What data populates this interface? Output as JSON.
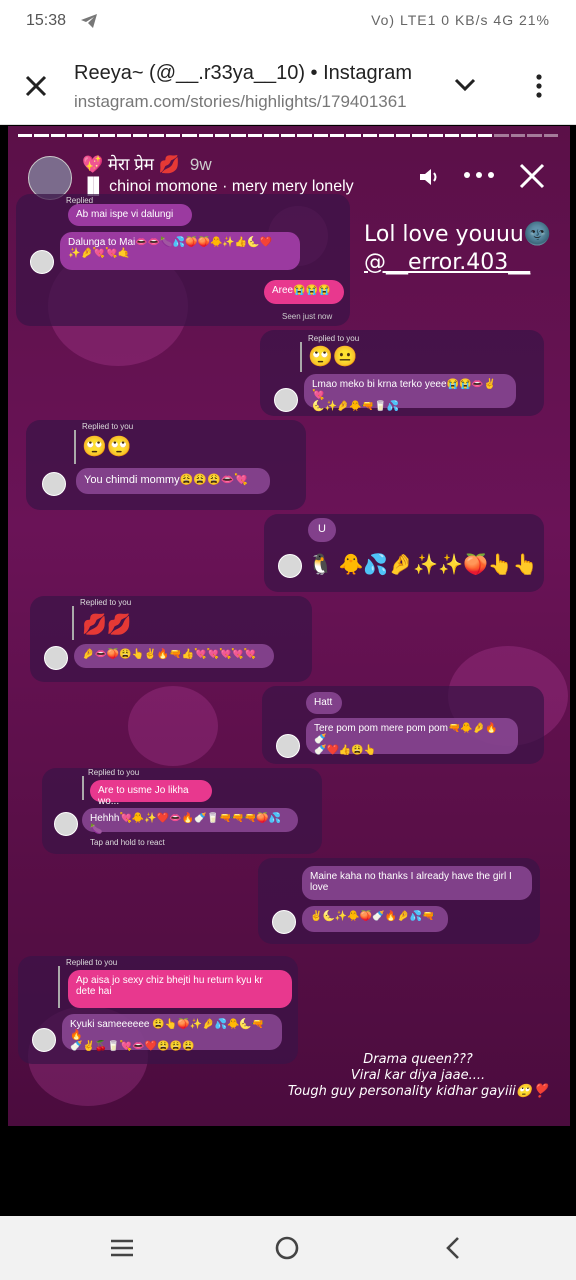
{
  "statusbar": {
    "time": "15:38",
    "right": "Vo) LTE1 0 KB/s 4G 21%",
    "telegram_icon": "telegram-icon"
  },
  "browser": {
    "title": "Reeya~ (@__.r33ya__10) • Instagram",
    "url": "instagram.com/stories/highlights/179401361"
  },
  "story": {
    "name": "💖 मेरा प्रेम 💋",
    "ago": "9w",
    "music": "chinoi momone · mery mery lonely",
    "overlay_lol": "Lol love youuu🌚",
    "overlay_handle": "@__error.403__",
    "caption": [
      "Drama queen???",
      "Viral kar diya jaae....",
      "Tough guy personality kidhar gayiii🙄❣️"
    ],
    "chat": {
      "c1_replied": "Replied",
      "c1_b1": "Ab mai ispe vi dalungi",
      "c1_b2": "Dalunga to Mai👄👄🍆💦🍑🍑🐥✨👍🌜❤️",
      "c1_b2b": "✨🤌💘💘🤙",
      "c1_b3": "Aree😭😭😭",
      "c1_seen": "Seen just now",
      "c2_replied": "Replied to you",
      "c2_emoji": "🙄😐",
      "c2_b1": "Lmao meko bi krna terko yeee😭😭👄✌️💘",
      "c2_b1b": "🌜✨🤌🐥🔫🥛💦",
      "c3_replied": "Replied to you",
      "c3_emoji": "🙄🙄",
      "c3_b1": "You chimdi mommy😩😩😩👄💘",
      "c4_b1": "U",
      "c4_emoji": "🐧 🐥💦🤌✨✨🍑👆👆",
      "c5_replied": "Replied to you",
      "c5_emoji": "💋💋",
      "c5_b1": "🤌👄🍑😩👆✌️🔥🔫👍💘💘💘💘💘",
      "c6_b1": "Hatt",
      "c6_b2": "Tere pom pom mere pom pom🔫🐥🤌🔥🍼",
      "c6_b2b": "🍼❤️👍😩👆",
      "c7_replied": "Replied to you",
      "c7_b1": "Are to usme Jo likha wo...",
      "c7_b2": "Hehhh💘🐥✨❤️👄🔥🍼🥛🔫🔫🔫🍑💦🍆",
      "c7_hint": "Tap and hold to react",
      "c8_b1": "Maine kaha no thanks I already have the girl I love",
      "c8_b2": "✌️🌜✨🐥🍑🍼🔥🤌💦🔫",
      "c9_replied": "Replied to you",
      "c9_b1": "Ap aisa jo sexy chiz bhejti hu return kyu kr dete hai",
      "c9_b2": "Kyuki sameeeeee 😩👆🍑✨🤌💦🐥🌜🔫🔥",
      "c9_b2b": "🍼✌️🍒🥛💘👄❤️😩😩😩"
    }
  },
  "icons": {
    "close": "close-icon",
    "chevron": "chevron-down-icon",
    "kebab": "more-vert-icon",
    "volume": "volume-icon",
    "more": "more-horiz-icon",
    "recent": "recents-icon",
    "home": "home-icon",
    "back": "back-icon"
  },
  "colors": {
    "story_bg": "#5b1048",
    "bubble_pink": "#e8388e",
    "bubble_purple": "#9b3aa0"
  }
}
